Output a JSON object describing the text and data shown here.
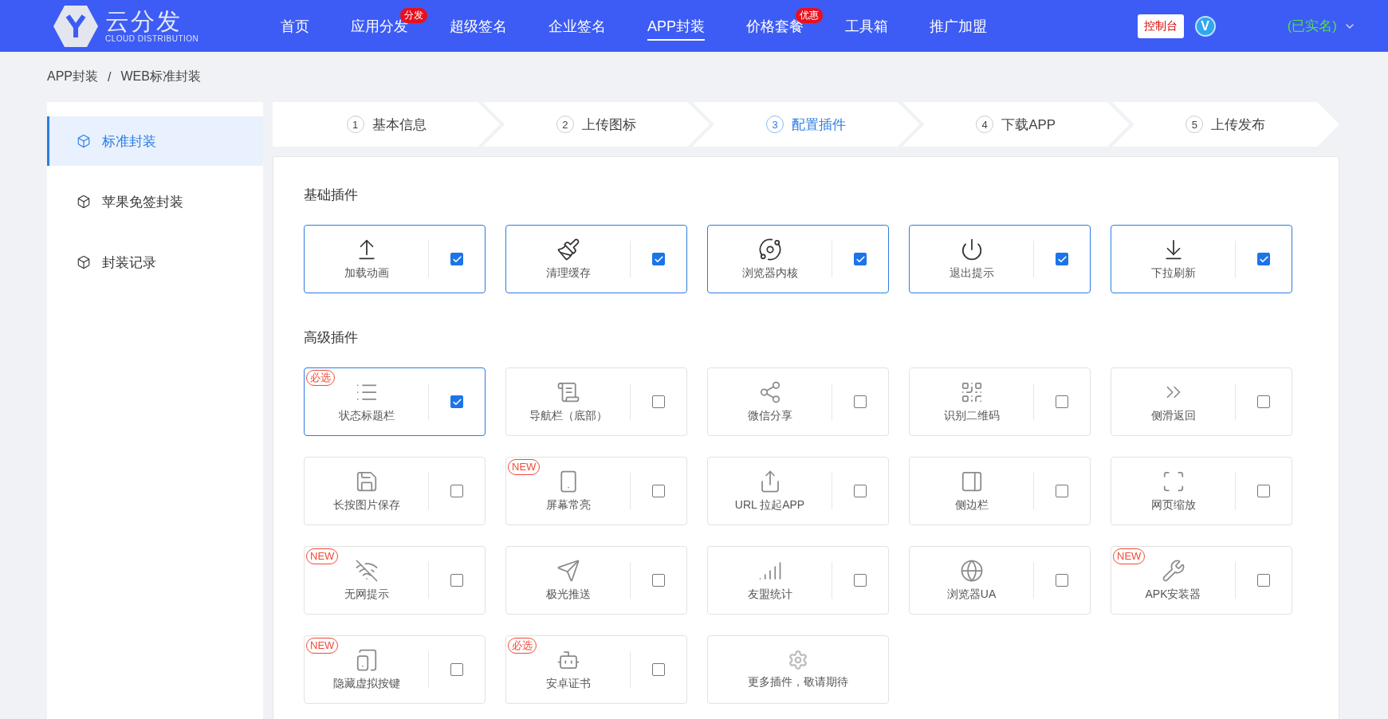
{
  "header": {
    "logo": {
      "name": "云分发",
      "subtitle": "CLOUD DISTRIBUTION"
    },
    "nav": [
      {
        "label": "首页",
        "selected": false
      },
      {
        "label": "应用分发",
        "selected": false,
        "badge": "分发"
      },
      {
        "label": "超级签名",
        "selected": false
      },
      {
        "label": "企业签名",
        "selected": false
      },
      {
        "label": "APP封装",
        "selected": true
      },
      {
        "label": "价格套餐",
        "selected": false,
        "badge": "优惠"
      },
      {
        "label": "工具箱",
        "selected": false
      },
      {
        "label": "推广加盟",
        "selected": false
      }
    ],
    "console_button": "控制台",
    "vip_badge": "V",
    "user": "(已实名)"
  },
  "breadcrumb": [
    "APP封装",
    "/",
    "WEB标准封装"
  ],
  "sidebar": {
    "items": [
      {
        "label": "标准封装",
        "selected": true
      },
      {
        "label": "苹果免签封装",
        "selected": false
      },
      {
        "label": "封装记录",
        "selected": false
      }
    ]
  },
  "steps": [
    {
      "number": "1",
      "label": "基本信息",
      "selected": false
    },
    {
      "number": "2",
      "label": "上传图标",
      "selected": false
    },
    {
      "number": "3",
      "label": "配置插件",
      "selected": true
    },
    {
      "number": "4",
      "label": "下载APP",
      "selected": false
    },
    {
      "number": "5",
      "label": "上传发布",
      "selected": false
    }
  ],
  "sections": [
    {
      "title": "基础插件",
      "plugins": [
        {
          "kind": "plugin",
          "label": "加载动画",
          "checked": true
        },
        {
          "kind": "plugin",
          "label": "清理缓存",
          "checked": true
        },
        {
          "kind": "plugin",
          "label": "浏览器内核",
          "checked": true
        },
        {
          "kind": "plugin",
          "label": "退出提示",
          "checked": true
        },
        {
          "kind": "plugin",
          "label": "下拉刷新",
          "checked": true
        }
      ]
    },
    {
      "title": "高级插件",
      "plugins": [
        {
          "kind": "plugin",
          "label": "状态标题栏",
          "checked": true,
          "badge": "必选"
        },
        {
          "kind": "plugin",
          "label": "导航栏（底部）",
          "checked": false
        },
        {
          "kind": "plugin",
          "label": "微信分享",
          "checked": false
        },
        {
          "kind": "plugin",
          "label": "识别二维码",
          "checked": false
        },
        {
          "kind": "plugin",
          "label": "侧滑返回",
          "checked": false
        },
        {
          "kind": "plugin",
          "label": "长按图片保存",
          "checked": false
        },
        {
          "kind": "plugin",
          "label": "屏幕常亮",
          "checked": false,
          "badge": "NEW"
        },
        {
          "kind": "plugin",
          "label": "URL 拉起APP",
          "checked": false
        },
        {
          "kind": "plugin",
          "label": "侧边栏",
          "checked": false
        },
        {
          "kind": "plugin",
          "label": "网页缩放",
          "checked": false
        },
        {
          "kind": "plugin",
          "label": "无网提示",
          "checked": false,
          "badge": "NEW"
        },
        {
          "kind": "plugin",
          "label": "极光推送",
          "checked": false
        },
        {
          "kind": "plugin",
          "label": "友盟统计",
          "checked": false
        },
        {
          "kind": "plugin",
          "label": "浏览器UA",
          "checked": false
        },
        {
          "kind": "plugin",
          "label": "APK安装器",
          "checked": false,
          "badge": "NEW"
        },
        {
          "kind": "plugin",
          "label": "隐藏虚拟按键",
          "checked": false,
          "badge": "NEW"
        },
        {
          "kind": "plugin",
          "label": "安卓证书",
          "checked": false,
          "badge": "必选"
        },
        {
          "kind": "more",
          "label": "更多插件，敬请期待"
        }
      ]
    }
  ]
}
